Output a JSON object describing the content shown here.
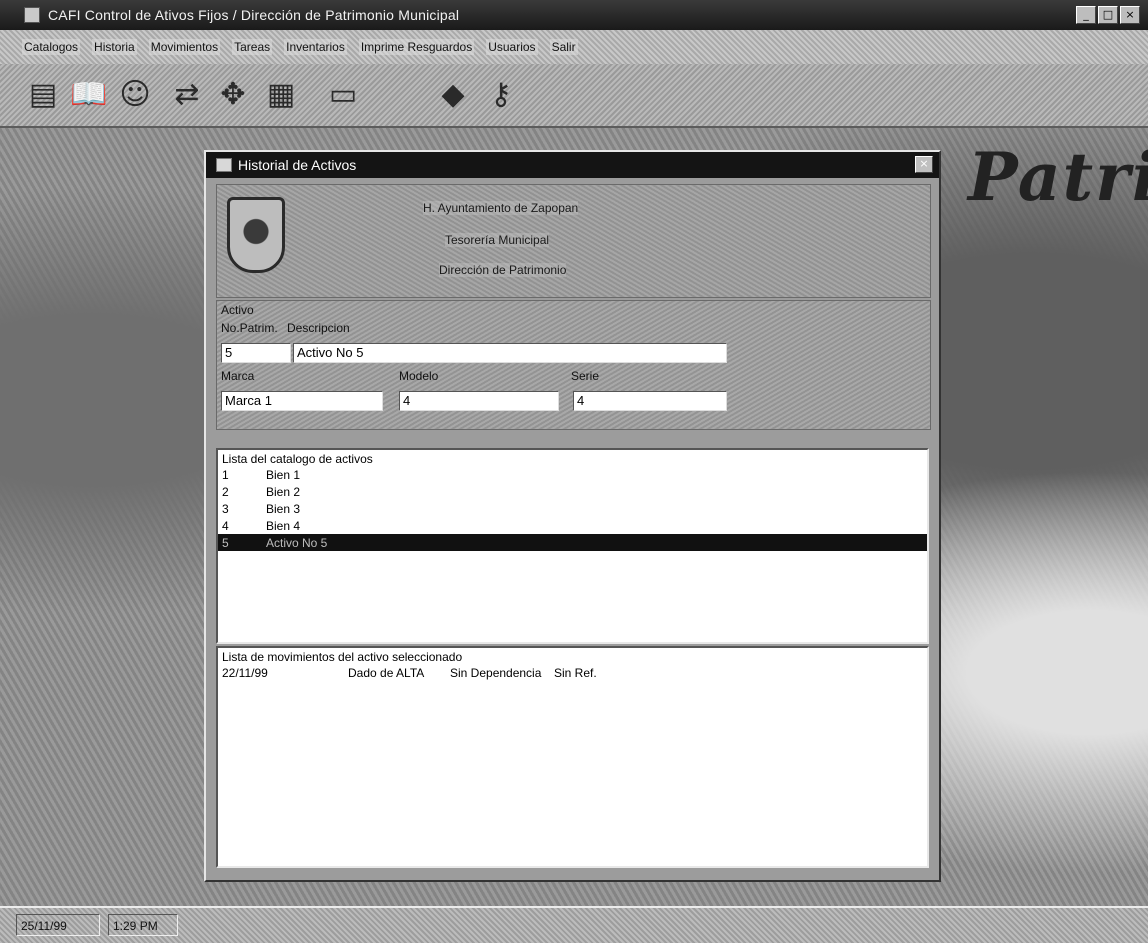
{
  "window": {
    "title": "CAFI Control de Ativos Fijos / Dirección de Patrimonio Municipal",
    "minimize_icon": "_",
    "maximize_icon": "□",
    "close_icon": "×"
  },
  "menu": [
    "Catalogos",
    "Historia",
    "Movimientos",
    "Tareas",
    "Inventarios",
    "Imprime Resguardos",
    "Usuarios",
    "Salir"
  ],
  "toolbar_icons": [
    "catalog-icon",
    "book-icon",
    "user-icon",
    "transfer-icon",
    "map-icon",
    "document-icon",
    "folder-icon",
    "printer-icon",
    "keys-icon"
  ],
  "background_text": "Patri",
  "dialog": {
    "title": "Historial de Activos",
    "close_icon": "×",
    "org": {
      "line1": "H. Ayuntamiento de Zapopan",
      "line2": "Tesorería Municipal",
      "line3": "Dirección de Patrimonio"
    },
    "form": {
      "section_label": "Activo",
      "no_patrim_label": "No.Patrim.",
      "descripcion_label": "Descripcion",
      "no_patrim_value": "5",
      "descripcion_value": "Activo No 5",
      "marca_label": "Marca",
      "modelo_label": "Modelo",
      "serie_label": "Serie",
      "marca_value": "Marca 1",
      "modelo_value": "4",
      "serie_value": "4"
    },
    "catalog": {
      "caption": "Lista del catalogo de activos",
      "rows": [
        {
          "no": "1",
          "desc": "Bien 1",
          "selected": false
        },
        {
          "no": "2",
          "desc": "Bien 2",
          "selected": false
        },
        {
          "no": "3",
          "desc": "Bien 3",
          "selected": false
        },
        {
          "no": "4",
          "desc": "Bien 4",
          "selected": false
        },
        {
          "no": "5",
          "desc": "Activo No 5",
          "selected": true
        }
      ]
    },
    "movements": {
      "caption": "Lista de movimientos del activo seleccionado",
      "rows": [
        {
          "date": "22/11/99",
          "type": "Dado de ALTA",
          "dependencia": "Sin Dependencia",
          "ref": "Sin Ref."
        }
      ]
    }
  },
  "status": {
    "date": "25/11/99",
    "time": "1:29 PM"
  }
}
